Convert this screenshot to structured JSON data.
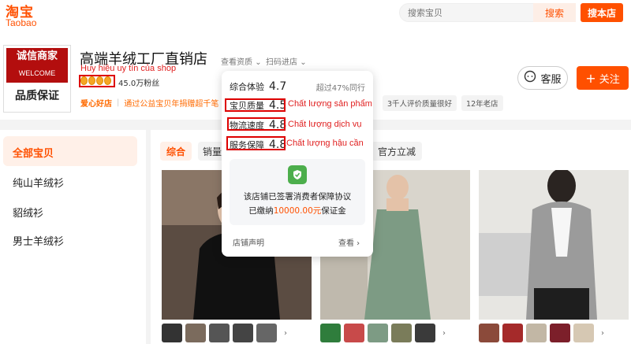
{
  "topbar": {
    "logo_cn": "淘宝",
    "logo_en": "Taobao",
    "search_placeholder": "搜索宝贝",
    "search_button": "搜索",
    "store_search_button": "搜本店"
  },
  "store": {
    "badge_line1": "诚信商家",
    "badge_line2": "WELCOME",
    "badge_line3": "品质保证",
    "name": "高端羊绒工厂直销店",
    "view_qualification": "查看资质",
    "scan_enter": "扫码进店",
    "followers": "45.0万粉丝",
    "charity_tag": "爱心好店",
    "charity_text": "通过公益宝贝年捐赠超千笔",
    "tags": [
      "3千人评价质量很好",
      "12年老店"
    ],
    "service_label": "客服",
    "follow_label": "关注"
  },
  "annotations": {
    "shop_badge": "Huy hiệu uy tín của shop",
    "product_quality": "Chất lượng sản phẩm",
    "logistics_service": "Chất lượng dịch vụ",
    "after_sales": "Chất lượng hậu cần"
  },
  "rating_popup": {
    "overall_label": "综合体验",
    "overall_score": "4.7",
    "overall_compare": "超过47%同行",
    "quality_label": "宝贝质量",
    "quality_score": "4.5",
    "logistics_label": "物流速度",
    "logistics_score": "4.8",
    "service_label": "服务保障",
    "service_score": "4.8",
    "guarantee_line1": "该店铺已签署消费者保障协议",
    "guarantee_line2_prefix": "已缴纳",
    "guarantee_amount": "10000.00元",
    "guarantee_line2_suffix": "保证金",
    "statement_link": "店铺声明",
    "view_link": "查看 ›"
  },
  "sidebar": {
    "items": [
      "全部宝贝",
      "纯山羊绒衫",
      "貂绒衫",
      "男士羊绒衫"
    ]
  },
  "tabs": {
    "items": [
      "综合",
      "销量",
      "官方立减"
    ]
  },
  "colors": {
    "brand_orange": "#ff5000",
    "annotation_red": "#e02020",
    "badge_red": "#b30e0e"
  }
}
